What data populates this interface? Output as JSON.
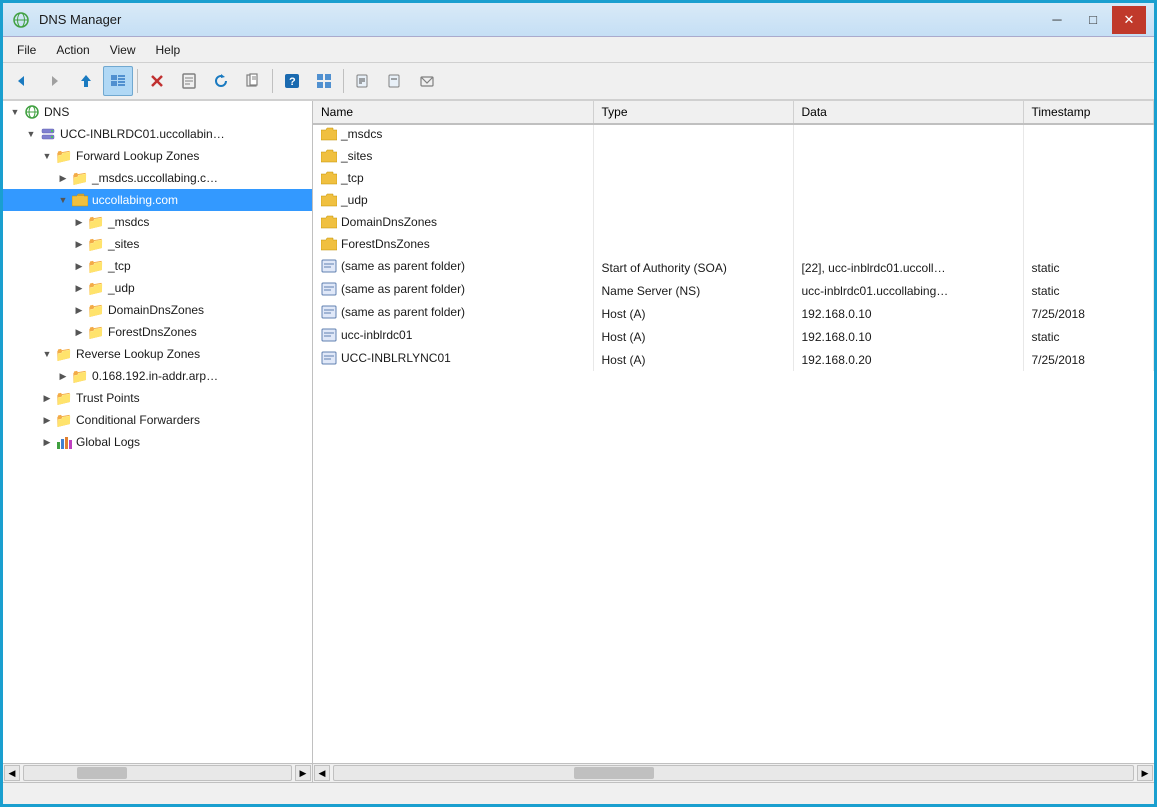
{
  "window": {
    "title": "DNS Manager",
    "controls": {
      "minimize": "─",
      "maximize": "□",
      "close": "✕"
    }
  },
  "menu": {
    "items": [
      "File",
      "Action",
      "View",
      "Help"
    ]
  },
  "toolbar": {
    "buttons": [
      {
        "name": "back",
        "icon": "◀",
        "active": false
      },
      {
        "name": "forward",
        "icon": "▶",
        "active": false
      },
      {
        "name": "up",
        "icon": "↑",
        "active": false
      },
      {
        "name": "show-detail",
        "icon": "▦",
        "active": true
      },
      {
        "name": "delete",
        "icon": "✖",
        "active": false
      },
      {
        "name": "properties",
        "icon": "⊟",
        "active": false
      },
      {
        "name": "refresh",
        "icon": "↺",
        "active": false
      },
      {
        "name": "export",
        "icon": "⎘",
        "active": false
      },
      {
        "name": "help",
        "icon": "?",
        "active": false
      },
      {
        "name": "view-toggle",
        "icon": "▤",
        "active": false
      },
      {
        "name": "new-host",
        "icon": "⊞",
        "active": false
      },
      {
        "name": "new-alias",
        "icon": "⊡",
        "active": false
      },
      {
        "name": "new-mail",
        "icon": "✉",
        "active": false
      }
    ]
  },
  "tree": {
    "items": [
      {
        "id": "dns-root",
        "label": "DNS",
        "level": 0,
        "icon": "dns",
        "toggle": "▼",
        "selected": false
      },
      {
        "id": "server",
        "label": "UCC-INBLRDC01.uccollabin…",
        "level": 1,
        "icon": "server",
        "toggle": "▼",
        "selected": false
      },
      {
        "id": "forward-zones",
        "label": "Forward Lookup Zones",
        "level": 2,
        "icon": "folder",
        "toggle": "▼",
        "selected": false
      },
      {
        "id": "msdcs-outer",
        "label": "_msdcs.uccollabing.c…",
        "level": 3,
        "icon": "folder",
        "toggle": "▶",
        "selected": false
      },
      {
        "id": "uccollabing",
        "label": "uccollabing.com",
        "level": 3,
        "icon": "folder-open",
        "toggle": "▼",
        "selected": true
      },
      {
        "id": "msdcs-inner",
        "label": "_msdcs",
        "level": 4,
        "icon": "folder",
        "toggle": "▶",
        "selected": false
      },
      {
        "id": "sites-inner",
        "label": "_sites",
        "level": 4,
        "icon": "folder",
        "toggle": "▶",
        "selected": false
      },
      {
        "id": "tcp-inner",
        "label": "_tcp",
        "level": 4,
        "icon": "folder",
        "toggle": "▶",
        "selected": false
      },
      {
        "id": "udp-inner",
        "label": "_udp",
        "level": 4,
        "icon": "folder",
        "toggle": "▶",
        "selected": false
      },
      {
        "id": "domaindns-inner",
        "label": "DomainDnsZones",
        "level": 4,
        "icon": "folder",
        "toggle": "▶",
        "selected": false
      },
      {
        "id": "forestdns-inner",
        "label": "ForestDnsZones",
        "level": 4,
        "icon": "folder",
        "toggle": "▶",
        "selected": false
      },
      {
        "id": "reverse-zones",
        "label": "Reverse Lookup Zones",
        "level": 2,
        "icon": "folder",
        "toggle": "▼",
        "selected": false
      },
      {
        "id": "reverse-zone-1",
        "label": "0.168.192.in-addr.arp…",
        "level": 3,
        "icon": "folder",
        "toggle": "▶",
        "selected": false
      },
      {
        "id": "trust-points",
        "label": "Trust Points",
        "level": 2,
        "icon": "folder",
        "toggle": "▶",
        "selected": false
      },
      {
        "id": "conditional",
        "label": "Conditional Forwarders",
        "level": 2,
        "icon": "folder",
        "toggle": "▶",
        "selected": false
      },
      {
        "id": "global-logs",
        "label": "Global Logs",
        "level": 2,
        "icon": "chart",
        "toggle": "▶",
        "selected": false
      }
    ]
  },
  "content": {
    "columns": [
      "Name",
      "Type",
      "Data",
      "Timestamp"
    ],
    "rows": [
      {
        "name": "_msdcs",
        "type": "",
        "data": "",
        "timestamp": "",
        "icon": "folder"
      },
      {
        "name": "_sites",
        "type": "",
        "data": "",
        "timestamp": "",
        "icon": "folder"
      },
      {
        "name": "_tcp",
        "type": "",
        "data": "",
        "timestamp": "",
        "icon": "folder"
      },
      {
        "name": "_udp",
        "type": "",
        "data": "",
        "timestamp": "",
        "icon": "folder"
      },
      {
        "name": "DomainDnsZones",
        "type": "",
        "data": "",
        "timestamp": "",
        "icon": "folder"
      },
      {
        "name": "ForestDnsZones",
        "type": "",
        "data": "",
        "timestamp": "",
        "icon": "folder"
      },
      {
        "name": "(same as parent folder)",
        "type": "Start of Authority (SOA)",
        "data": "[22], ucc-inblrdc01.uccoll…",
        "timestamp": "static",
        "icon": "record"
      },
      {
        "name": "(same as parent folder)",
        "type": "Name Server (NS)",
        "data": "ucc-inblrdc01.uccollabing…",
        "timestamp": "static",
        "icon": "record"
      },
      {
        "name": "(same as parent folder)",
        "type": "Host (A)",
        "data": "192.168.0.10",
        "timestamp": "7/25/2018",
        "icon": "record"
      },
      {
        "name": "ucc-inblrdc01",
        "type": "Host (A)",
        "data": "192.168.0.10",
        "timestamp": "static",
        "icon": "record"
      },
      {
        "name": "UCC-INBLRLYNC01",
        "type": "Host (A)",
        "data": "192.168.0.20",
        "timestamp": "7/25/2018",
        "icon": "record"
      }
    ]
  }
}
